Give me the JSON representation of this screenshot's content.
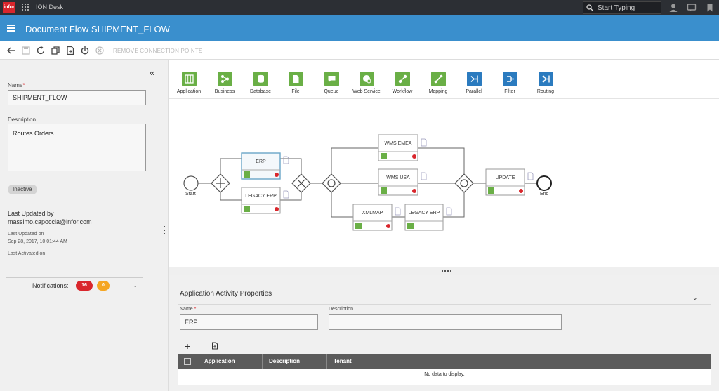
{
  "topbar": {
    "logo": "infor",
    "app_name": "ION Desk",
    "search_placeholder": "Start Typing"
  },
  "header": {
    "title": "Document Flow SHIPMENT_FLOW"
  },
  "toolbar": {
    "remove_connection_points": "REMOVE CONNECTION POINTS"
  },
  "left": {
    "name_label": "Name",
    "name_value": "SHIPMENT_FLOW",
    "description_label": "Description",
    "description_value": "Routes Orders",
    "status": "Inactive",
    "last_updated_by_label": "Last Updated by",
    "last_updated_by": "massimo.capoccia@infor.com",
    "last_updated_on_label": "Last Updated on",
    "last_updated_on": "Sep 28, 2017, 10:01:44 AM",
    "last_activated_on_label": "Last Activated on",
    "notifications_label": "Notifications:",
    "notifications_error_count": "16",
    "notifications_warning_count": "0"
  },
  "palette": [
    {
      "label": "Application",
      "color": "#6aaf46"
    },
    {
      "label": "Business",
      "color": "#6aaf46"
    },
    {
      "label": "Database",
      "color": "#6aaf46"
    },
    {
      "label": "File",
      "color": "#6aaf46"
    },
    {
      "label": "Queue",
      "color": "#6aaf46"
    },
    {
      "label": "Web Service",
      "color": "#6aaf46"
    },
    {
      "label": "Workflow",
      "color": "#6aaf46"
    },
    {
      "label": "Mapping",
      "color": "#6aaf46"
    },
    {
      "label": "Parallel",
      "color": "#2b7bbf"
    },
    {
      "label": "Filter",
      "color": "#2b7bbf"
    },
    {
      "label": "Routing",
      "color": "#2b7bbf"
    }
  ],
  "flow": {
    "start_label": "Start",
    "end_label": "End",
    "nodes": [
      "ERP",
      "LEGACY ERP",
      "WMS EMEA",
      "WMS USA",
      "XMLMAP",
      "LEGACY ERP",
      "UPDATE"
    ]
  },
  "properties": {
    "title": "Application Activity Properties",
    "name_label": "Name",
    "name_value": "ERP",
    "description_label": "Description",
    "description_value": "",
    "columns": [
      "Application",
      "Description",
      "Tenant"
    ],
    "empty_text": "No data to display."
  },
  "colors": {
    "accent": "#3a8fcd",
    "activity_green": "#6aaf46",
    "routing_blue": "#2b7bbf",
    "error_red": "#d9262c",
    "warning_orange": "#f5a623"
  }
}
